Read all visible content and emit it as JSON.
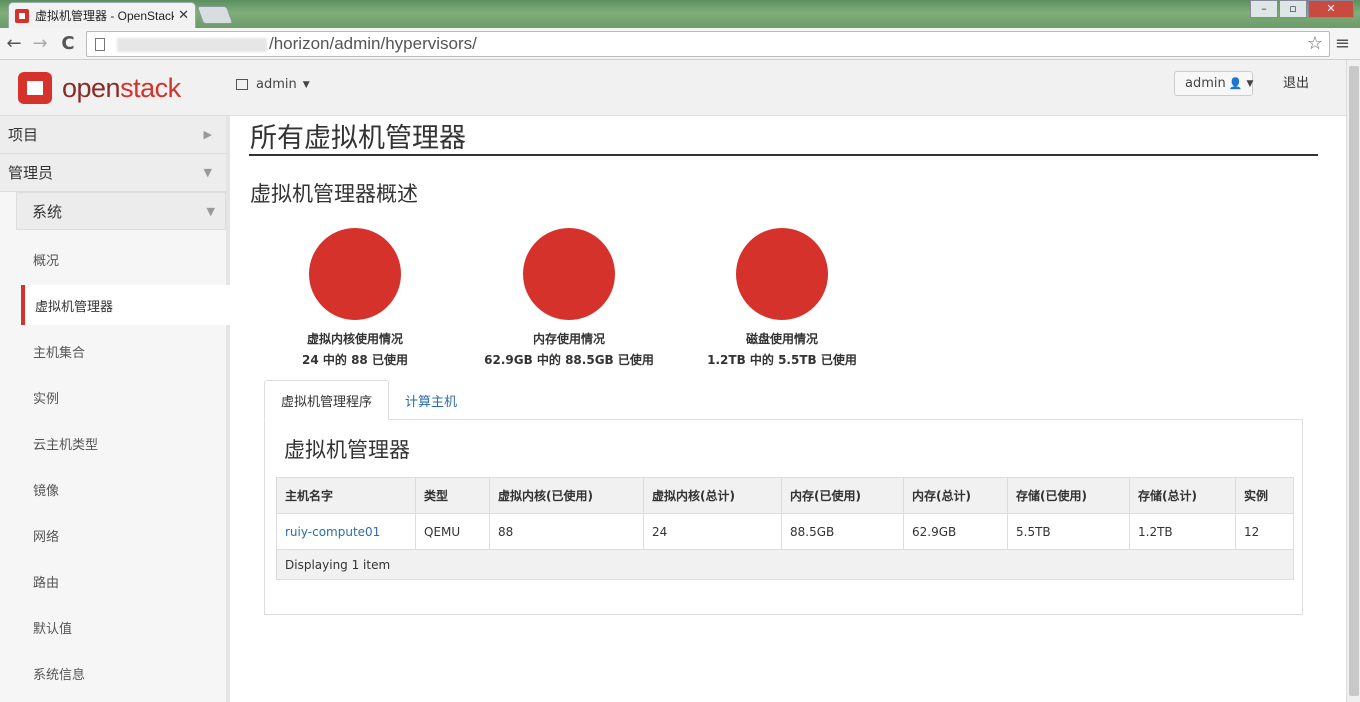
{
  "browser": {
    "tab_title": "虚拟机管理器 - OpenStack",
    "tab_close": "✕",
    "url_visible": "/horizon/admin/hypervisors/",
    "back": "←",
    "forward": "→",
    "reload": "C",
    "star": "☆",
    "menu": "≡",
    "win_min": "–",
    "win_max": "▫",
    "win_close": "✕"
  },
  "header": {
    "logo_open": "open",
    "logo_stack": "stack",
    "project_label": "admin",
    "user_label": "admin",
    "signout_label": "退出"
  },
  "sidebar": {
    "project_label": "项目",
    "admin_label": "管理员",
    "system_label": "系统",
    "items": [
      {
        "label": "概况"
      },
      {
        "label": "虚拟机管理器",
        "active": true
      },
      {
        "label": "主机集合"
      },
      {
        "label": "实例"
      },
      {
        "label": "云主机类型"
      },
      {
        "label": "镜像"
      },
      {
        "label": "网络"
      },
      {
        "label": "路由"
      },
      {
        "label": "默认值"
      },
      {
        "label": "系统信息"
      }
    ]
  },
  "main": {
    "page_title": "所有虚拟机管理器",
    "overview_title": "虚拟机管理器概述",
    "pies": [
      {
        "label": "虚拟内核使用情况",
        "value": "24 中的 88 已使用"
      },
      {
        "label": "内存使用情况",
        "value": "62.9GB 中的 88.5GB 已使用"
      },
      {
        "label": "磁盘使用情况",
        "value": "1.2TB 中的 5.5TB 已使用"
      }
    ],
    "tabs": [
      {
        "label": "虚拟机管理程序",
        "active": true
      },
      {
        "label": "计算主机",
        "active": false
      }
    ],
    "table_title": "虚拟机管理器",
    "columns": [
      "主机名字",
      "类型",
      "虚拟内核(已使用)",
      "虚拟内核(总计)",
      "内存(已使用)",
      "内存(总计)",
      "存储(已使用)",
      "存储(总计)",
      "实例"
    ],
    "rows": [
      [
        "ruiy-compute01",
        "QEMU",
        "88",
        "24",
        "88.5GB",
        "62.9GB",
        "5.5TB",
        "1.2TB",
        "12"
      ]
    ],
    "footer": "Displaying 1 item"
  },
  "colors": {
    "accent": "#d6322c",
    "link": "#2a6ea8"
  }
}
